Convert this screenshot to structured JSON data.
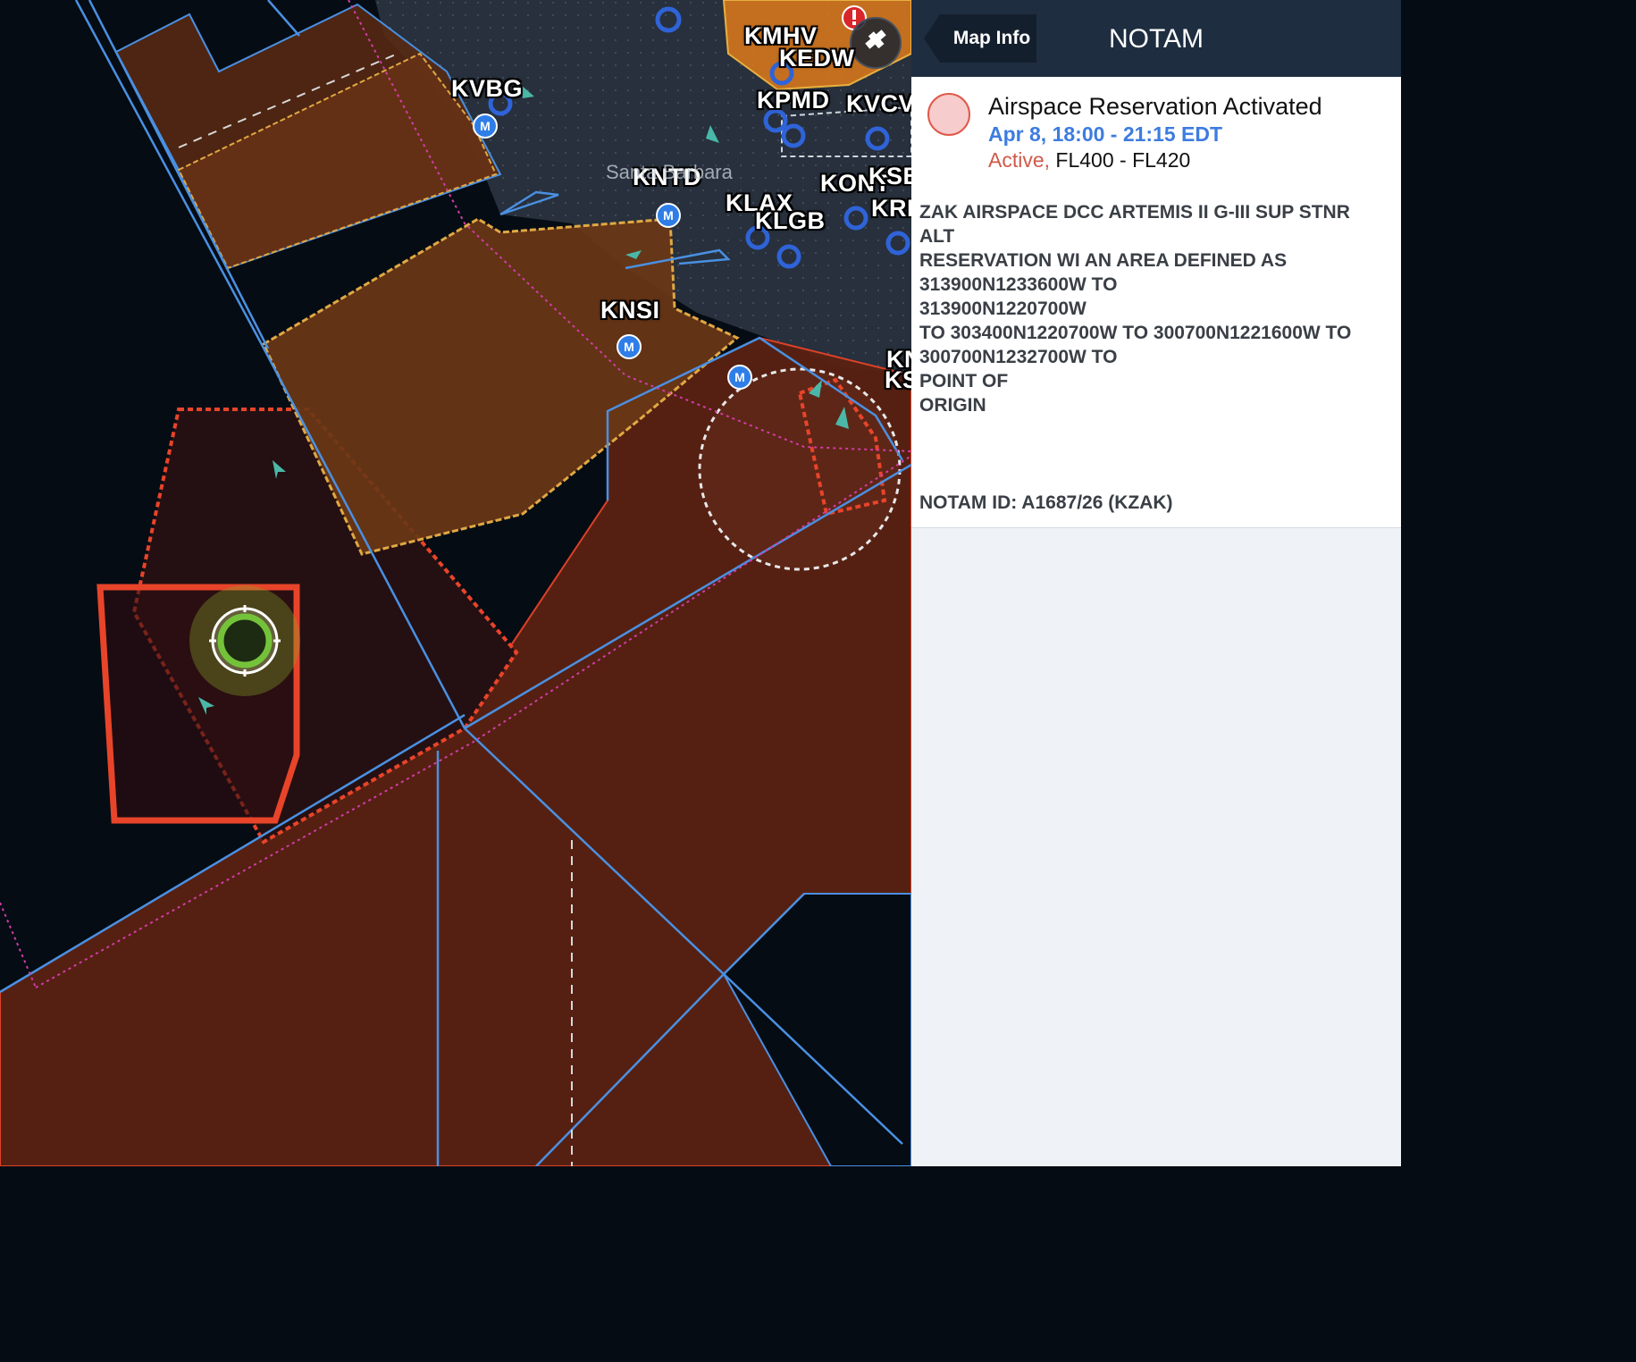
{
  "panel": {
    "back_button_label": "Map Info",
    "title": "NOTAM",
    "notam": {
      "heading": "Airspace Reservation Activated",
      "time_range": "Apr 8, 18:00 - 21:15 EDT",
      "status": "Active,",
      "altitudes": "FL400 - FL420",
      "text_lines": [
        "ZAK AIRSPACE DCC ARTEMIS II G-III SUP STNR",
        "ALT",
        "RESERVATION WI AN AREA DEFINED AS",
        "313900N1233600W TO",
        "313900N1220700W",
        "TO 303400N1220700W TO 300700N1221600W TO",
        "300700N1232700W TO",
        "POINT OF",
        "ORIGIN"
      ],
      "notam_id": "NOTAM ID: A1687/26 (KZAK)",
      "status_color": "#d05a4a",
      "time_color": "#3d7ce0"
    }
  },
  "map": {
    "airports": [
      "KMHV",
      "KEDW",
      "KVBG",
      "KPMD",
      "KVCV",
      "KNTD",
      "KLAX",
      "KLGB",
      "KONT",
      "KSB",
      "KRI",
      "KNSI",
      "KN",
      "KS"
    ],
    "city_label": "Santa Barbara",
    "military_badge_label": "M",
    "colors": {
      "ocean": "#050c14",
      "land": "#27303c",
      "airspace_fill": "#5a2212",
      "notam_fill": "#2a1010",
      "notam_outline": "#e8442a",
      "boundary_blue": "#4a90e2",
      "magenta_route": "#d23ca8"
    },
    "icons": [
      "center-position-icon",
      "alert-icon",
      "gps-satellite-icon",
      "airport-icon",
      "traffic-arrow-icon"
    ]
  }
}
